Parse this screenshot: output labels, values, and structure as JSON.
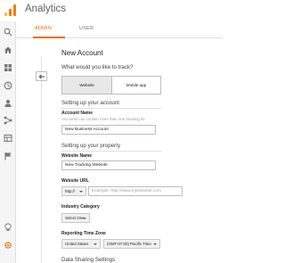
{
  "app": {
    "title": "Analytics"
  },
  "colors": {
    "accent": "#ef6c00",
    "rail_bg": "#f5f5f5",
    "logo_orange": "#f57c00",
    "logo_yellow": "#fbc02d"
  },
  "rail": {
    "icons": [
      "search-icon",
      "home-icon",
      "customization-icon",
      "clock-icon",
      "audience-icon",
      "acquisition-icon",
      "behavior-icon",
      "flag-icon",
      "lightbulb-icon",
      "gear-icon"
    ]
  },
  "tabs": [
    {
      "label": "ADMIN",
      "active": true
    },
    {
      "label": "USER",
      "active": false
    }
  ],
  "form": {
    "title": "New Account",
    "track_question": "What would you like to track?",
    "track_options": [
      {
        "label": "Website",
        "selected": true
      },
      {
        "label": "Mobile app",
        "selected": false
      }
    ],
    "account_section": "Setting up your account",
    "account_name_label": "Account Name",
    "account_name_hint": "Accounts can contain more than one tracking ID.",
    "account_name_value": "New Business Account",
    "property_section": "Setting up your property",
    "website_name_label": "Website Name",
    "website_name_value": "New Tracking Website",
    "website_url_label": "Website URL",
    "url_protocol": "http://",
    "url_placeholder": "Example: http://www.mywebsite.com",
    "industry_label": "Industry Category",
    "industry_value": "Select One",
    "timezone_label": "Reporting Time Zone",
    "timezone_country": "United States",
    "timezone_zone": "(GMT-07:00) Pacific Time",
    "sharing_section": "Data Sharing Settings"
  }
}
